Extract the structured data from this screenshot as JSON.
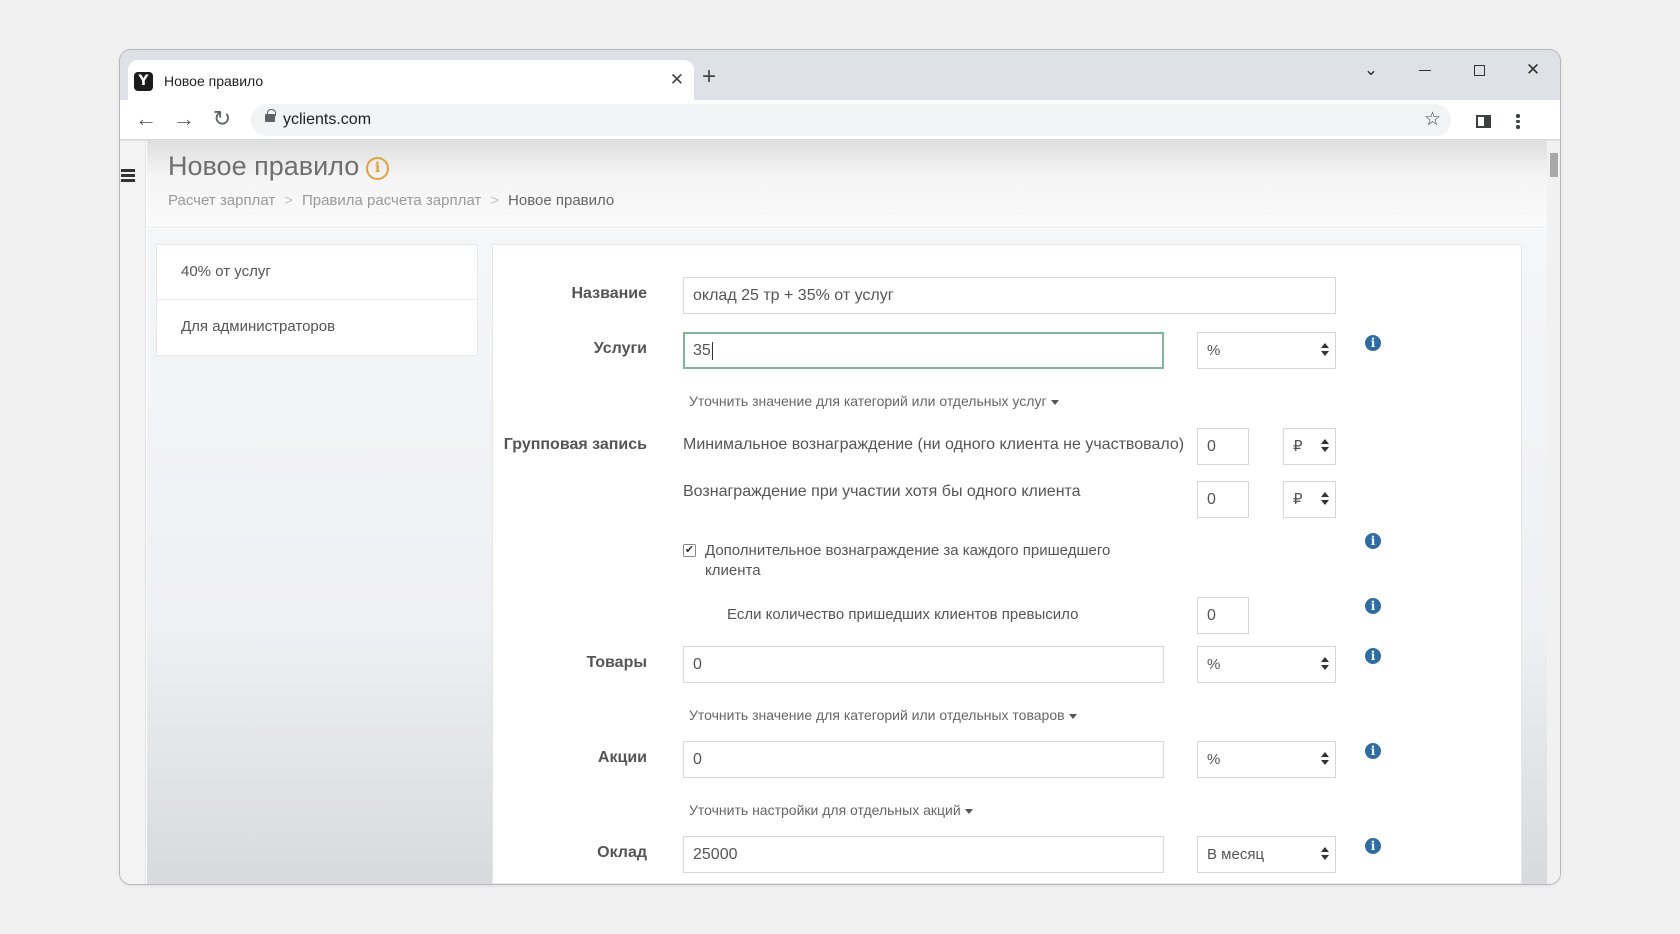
{
  "browser": {
    "tab_title": "Новое правило",
    "tab_favicon": "Y",
    "url": "yclients.com",
    "icons": {
      "back": "arrow-left-icon",
      "forward": "arrow-right-icon",
      "reload": "reload-icon",
      "star": "star-icon",
      "new_tab": "plus-icon"
    }
  },
  "page": {
    "title": "Новое правило",
    "breadcrumb": [
      "Расчет зарплат",
      "Правила расчета зарплат",
      "Новое правило"
    ],
    "breadcrumb_separator": ">"
  },
  "rules_list": [
    {
      "label": "40% от услуг"
    },
    {
      "label": "Для администраторов"
    }
  ],
  "form": {
    "name": {
      "label": "Название",
      "value": "оклад 25 тр + 35% от услуг"
    },
    "services": {
      "label": "Услуги",
      "value": "35",
      "unit": "%",
      "refine_link": "Уточнить значение для категорий или отдельных услуг"
    },
    "group": {
      "label": "Групповая запись",
      "min_reward": {
        "text": "Минимальное вознаграждение (ни одного клиента не участвовало)",
        "value": "0",
        "unit": "₽"
      },
      "reward_one": {
        "text": "Вознаграждение при участии хотя бы одного клиента",
        "value": "0",
        "unit": "₽"
      },
      "extra_reward": {
        "checked": true,
        "text_line1": "Дополнительное вознаграждение за каждого пришедшего",
        "text_line2": "клиента"
      },
      "threshold": {
        "text": "Если количество пришедших клиентов превысило",
        "value": "0"
      }
    },
    "goods": {
      "label": "Товары",
      "value": "0",
      "unit": "%",
      "refine_link": "Уточнить значение для категорий или отдельных товаров"
    },
    "promos": {
      "label": "Акции",
      "value": "0",
      "unit": "%",
      "refine_link": "Уточнить настройки для отдельных акций"
    },
    "salary": {
      "label": "Оклад",
      "value": "25000",
      "unit": "В месяц"
    }
  },
  "colors": {
    "focus_border": "#7fb69a",
    "info_icon": "#2e6da4",
    "title_info": "#e0a13f"
  }
}
